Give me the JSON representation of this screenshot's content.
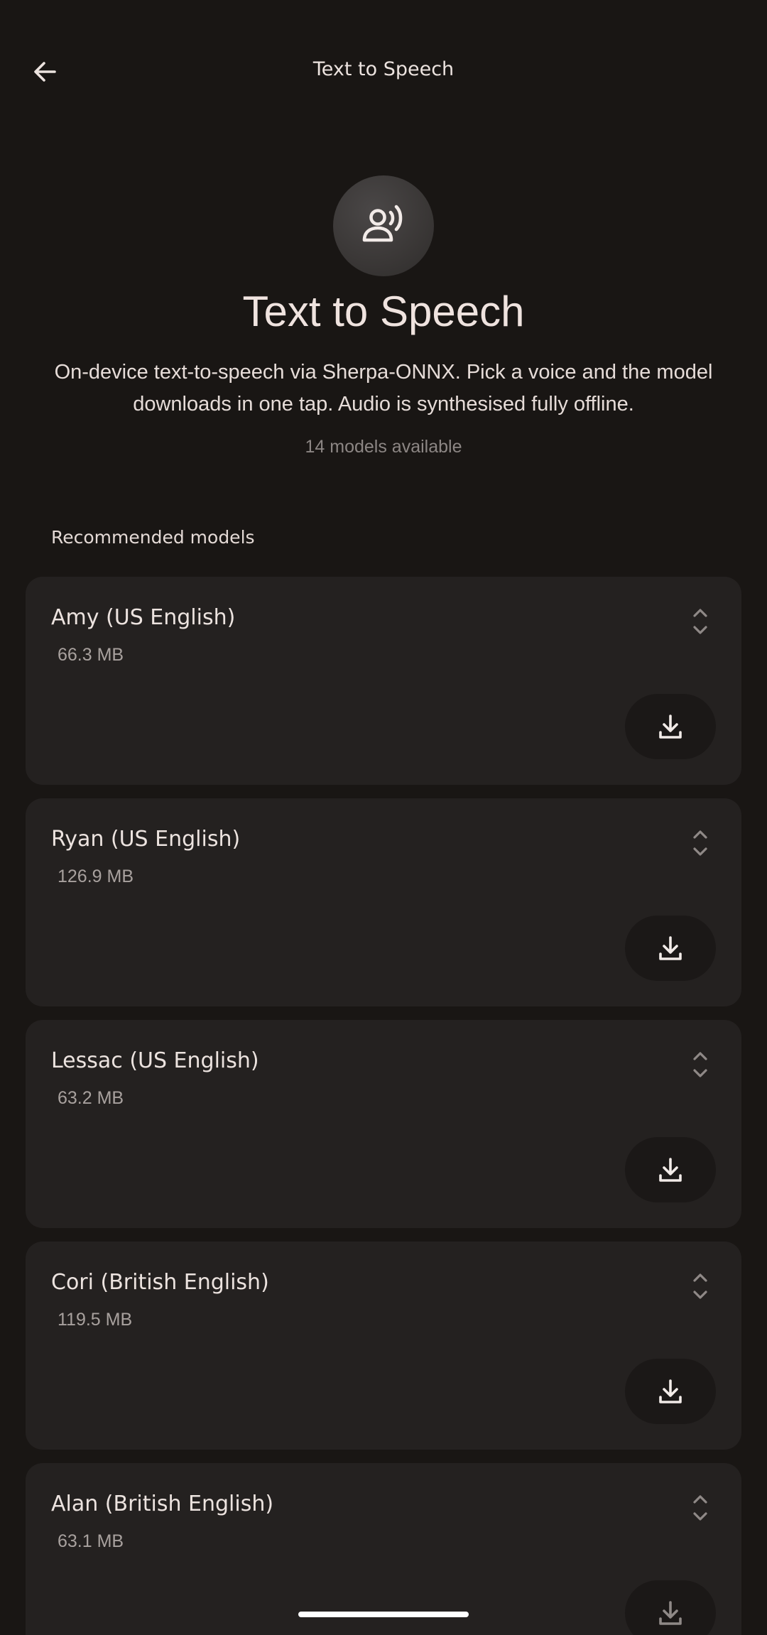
{
  "topbar": {
    "title": "Text to Speech",
    "back_icon": "arrow-left-icon"
  },
  "hero": {
    "icon": "voice-speaker-icon",
    "title": "Text to Speech",
    "description": "On-device text-to-speech via Sherpa-ONNX. Pick a voice and the model downloads in one tap. Audio is synthesised fully offline.",
    "count": "14 models available"
  },
  "section": {
    "label": "Recommended models"
  },
  "models": [
    {
      "name": "Amy (US English)",
      "size": "66.3 MB"
    },
    {
      "name": "Ryan (US English)",
      "size": "126.9 MB"
    },
    {
      "name": "Lessac (US English)",
      "size": "63.2 MB"
    },
    {
      "name": "Cori (British English)",
      "size": "119.5 MB"
    },
    {
      "name": "Alan (British English)",
      "size": "63.1 MB"
    }
  ],
  "colors": {
    "background": "#191614",
    "card": "#242120",
    "text": "#ece3df",
    "muted": "#a8a19e"
  }
}
